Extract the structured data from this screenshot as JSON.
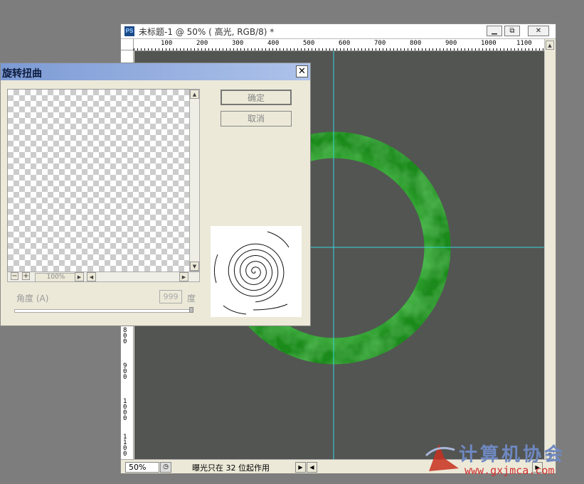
{
  "document": {
    "app_icon": "PS",
    "title": "未标题-1 @ 50% ( 高光, RGB/8) *",
    "window_buttons": {
      "minimize": "▁",
      "restore": "⧉",
      "close": "✕"
    },
    "ruler_h": [
      "100",
      "200",
      "300",
      "400",
      "500",
      "600",
      "700",
      "800",
      "900",
      "1000",
      "1100"
    ],
    "ruler_v_visible": [
      "800",
      "900",
      "1000",
      "1100"
    ],
    "canvas_color": "#535553",
    "guide_color": "#37d5dc",
    "ring_color": "#3fbf3f",
    "status": {
      "zoom": "50%",
      "message": "曝光只在 32 位起作用"
    }
  },
  "dialog": {
    "title": "旋转扭曲",
    "close_label": "✕",
    "ok_label": "确定",
    "cancel_label": "取消",
    "preview_zoom": "100%",
    "zoom_out_label": "−",
    "zoom_in_label": "+",
    "angle_label": "角度 (A)",
    "angle_value": "999",
    "angle_unit": "度",
    "angle_slider_fraction": 1.0,
    "thumbnail_icon": "twirl-spiral-icon"
  },
  "watermark": {
    "name": "计算机协会",
    "url": "www.gxjmca.com"
  }
}
